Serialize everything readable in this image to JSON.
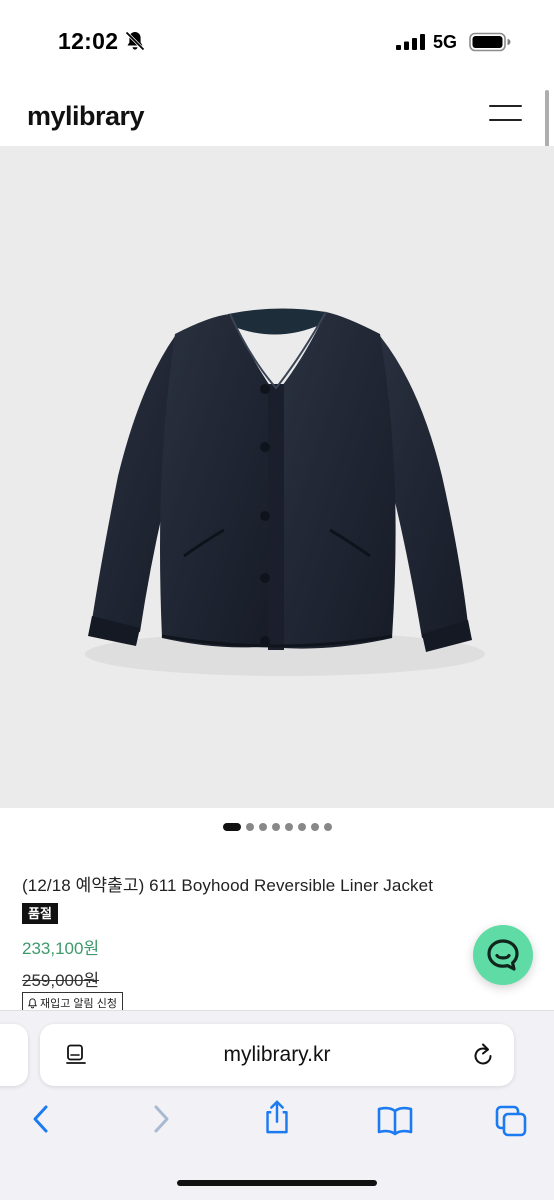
{
  "status_bar": {
    "time": "12:02",
    "network": "5G",
    "icons": [
      "bell-slash-icon",
      "signal-bars-icon",
      "battery-icon"
    ]
  },
  "header": {
    "logo": "mylibrary",
    "menu_icon": "hamburger-menu-icon"
  },
  "product": {
    "image": "navy-reversible-liner-jacket",
    "carousel": {
      "total": 8,
      "active_index": 0
    },
    "title": "(12/18 예약출고) 611 Boyhood Reversible Liner Jacket",
    "soldout_badge": "품절",
    "sale_price": "233,100원",
    "original_price": "259,000원",
    "restock_label": "재입고 알림 신청"
  },
  "chat_button": {
    "icon": "chat-smile-icon",
    "color": "#5fdba6"
  },
  "browser": {
    "url": "mylibrary.kr",
    "toolbar_icons": [
      "back-arrow-icon",
      "forward-arrow-icon",
      "share-icon",
      "bookmarks-icon",
      "tabs-icon"
    ],
    "accent_color": "#1d7bf2"
  }
}
